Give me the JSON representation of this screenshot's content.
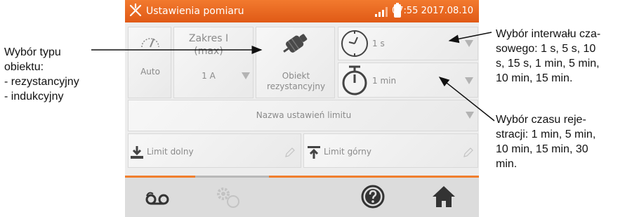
{
  "header": {
    "title": "Ustawienia pomiaru",
    "time_date": "07:55 2017.08.10"
  },
  "tiles": {
    "auto_label": "Auto",
    "range_title_line1": "Zakres I",
    "range_title_line2": "(max)",
    "range_value": "1 A",
    "object_label_line1": "Obiekt",
    "object_label_line2": "rezystancyjny",
    "interval_value": "1 s",
    "duration_value": "1 min",
    "limit_settings_label": "Nazwa ustawień limitu",
    "limit_lower_label": "Limit dolny",
    "limit_upper_label": "Limit górny"
  },
  "annotations": {
    "object_type": [
      "Wybór typu",
      "obiektu:",
      "- rezystancyjny",
      "- indukcyjny"
    ],
    "interval": [
      "Wybór interwału cza-",
      "sowego: 1 s, 5 s, 10",
      "s, 15 s, 1 min, 5 min,",
      "10 min, 15 min."
    ],
    "duration": [
      "Wybór czasu reje-",
      "stracji: 1 min, 5 min,",
      "10 min, 15 min, 30",
      "min."
    ]
  },
  "colors": {
    "accent": "#e8661e",
    "panel": "#ededed",
    "text_muted": "#8a8a8a"
  },
  "icons": [
    "meter-logo-icon",
    "signal-icon",
    "battery-icon",
    "gauge-icon",
    "probe-icon",
    "clock-icon",
    "stopwatch-icon",
    "download-icon",
    "upload-icon",
    "pencil-icon",
    "recording-icon",
    "settings-gears-icon",
    "help-icon",
    "home-icon"
  ]
}
